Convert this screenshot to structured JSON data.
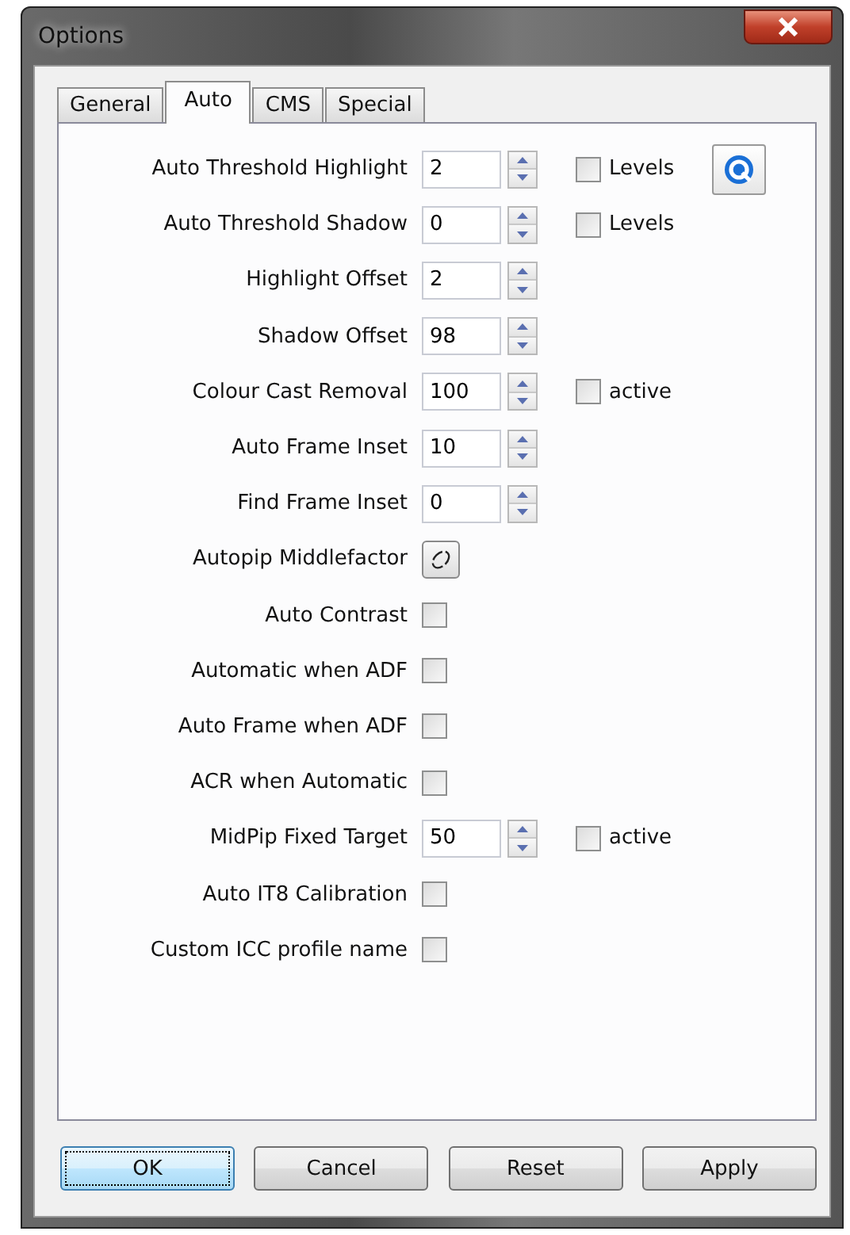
{
  "window": {
    "title": "Options"
  },
  "tabs": [
    {
      "label": "General",
      "selected": false
    },
    {
      "label": "Auto",
      "selected": true
    },
    {
      "label": "CMS",
      "selected": false
    },
    {
      "label": "Special",
      "selected": false
    }
  ],
  "rows": [
    {
      "kind": "spin",
      "label": "Auto Threshold Highlight",
      "value": "2",
      "option": {
        "label": "Levels",
        "checked": false
      },
      "tool_button": true
    },
    {
      "kind": "spin",
      "label": "Auto Threshold Shadow",
      "value": "0",
      "option": {
        "label": "Levels",
        "checked": false
      }
    },
    {
      "kind": "spin",
      "label": "Highlight Offset",
      "value": "2"
    },
    {
      "kind": "spin",
      "label": "Shadow Offset",
      "value": "98"
    },
    {
      "kind": "spin",
      "label": "Colour Cast Removal",
      "value": "100",
      "option": {
        "label": "active",
        "checked": false
      }
    },
    {
      "kind": "spin",
      "label": "Auto Frame Inset",
      "value": "10"
    },
    {
      "kind": "spin",
      "label": "Find Frame Inset",
      "value": "0"
    },
    {
      "kind": "button",
      "label": "Autopip Middlefactor"
    },
    {
      "kind": "check",
      "label": "Auto Contrast",
      "checked": false
    },
    {
      "kind": "check",
      "label": "Automatic when ADF",
      "checked": false
    },
    {
      "kind": "check",
      "label": "Auto Frame when ADF",
      "checked": false
    },
    {
      "kind": "check",
      "label": "ACR when Automatic",
      "checked": false
    },
    {
      "kind": "spin",
      "label": "MidPip Fixed Target",
      "value": "50",
      "option": {
        "label": "active",
        "checked": false
      }
    },
    {
      "kind": "check",
      "label": "Auto IT8 Calibration",
      "checked": false
    },
    {
      "kind": "check",
      "label": "Custom ICC profile name",
      "checked": false
    }
  ],
  "buttons": [
    {
      "label": "OK",
      "default": true
    },
    {
      "label": "Cancel",
      "default": false
    },
    {
      "label": "Reset",
      "default": false
    },
    {
      "label": "Apply",
      "default": false
    }
  ]
}
